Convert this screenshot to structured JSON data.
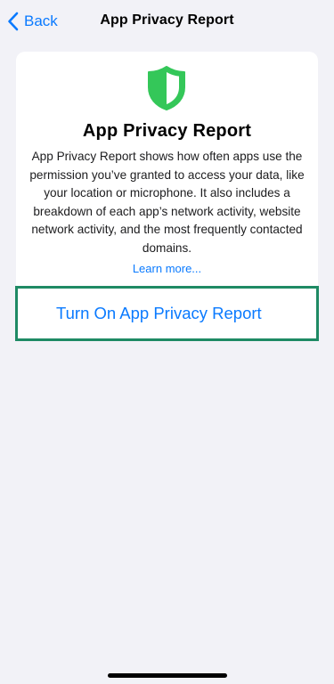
{
  "nav": {
    "back_label": "Back",
    "title": "App Privacy Report"
  },
  "card": {
    "icon": "shield-icon",
    "title": "App Privacy Report",
    "description": "App Privacy Report shows how often apps use the permission you’ve granted to access your data, like your location or microphone. It also includes a breakdown of each app’s network activity, website network activity, and the most frequently contacted domains.",
    "learn_more": "Learn more..."
  },
  "action": {
    "turn_on_label": "Turn On App Privacy Report"
  },
  "colors": {
    "accent_blue": "#0a7aff",
    "shield_green": "#34c759",
    "highlight_border": "#1e8a64",
    "background": "#f2f2f7"
  }
}
